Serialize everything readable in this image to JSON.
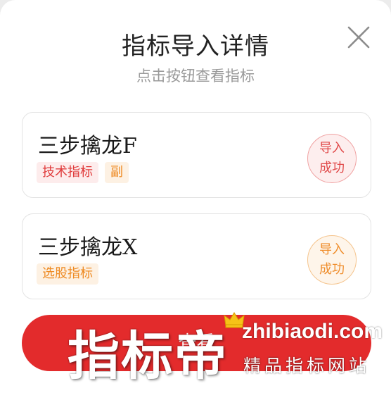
{
  "dialog": {
    "title": "指标导入详情",
    "subtitle": "点击按钮查看指标"
  },
  "icons": {
    "close": "close-icon",
    "crown": "crown-icon"
  },
  "indicators": [
    {
      "name": "三步擒龙F",
      "tags": [
        "技术指标",
        "副"
      ],
      "status_line1": "导入",
      "status_line2": "成功",
      "status_color": "#e04848"
    },
    {
      "name": "三步擒龙X",
      "tags": [
        "选股指标"
      ],
      "status_line1": "导入",
      "status_line2": "成功",
      "status_color": "#ef8d2b"
    }
  ],
  "footer": {
    "view_button_label": "查看"
  },
  "watermark": {
    "brand": "指标帝",
    "url": "zhibiaodi.com",
    "slogan": "精品指标网站"
  },
  "colors": {
    "accent_red": "#e32b2c",
    "tag_red": "#e03b3b",
    "tag_orange": "#ee8a22"
  }
}
